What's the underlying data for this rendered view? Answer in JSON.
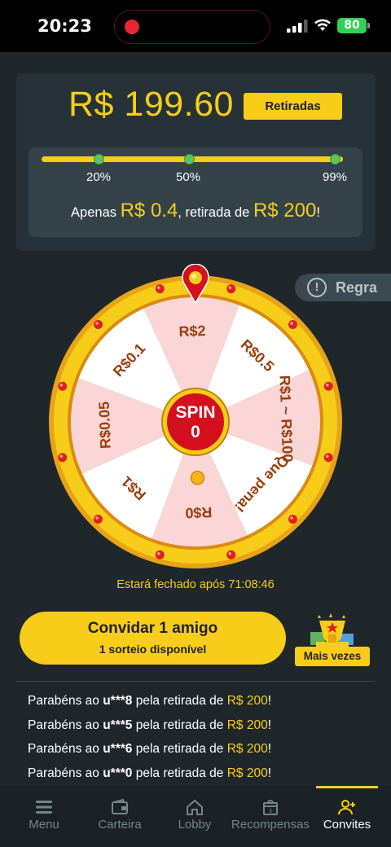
{
  "status_bar": {
    "time": "20:23",
    "battery": "80",
    "icons": [
      "recording-dot-icon",
      "signal-icon",
      "wifi-icon",
      "battery-icon"
    ]
  },
  "balance_card": {
    "amount": "R$ 199.60",
    "withdraw_button": "Retiradas",
    "progress": {
      "markers": [
        "20%",
        "50%",
        "99%"
      ],
      "fill_fraction": 0.998,
      "message_prefix": "Apenas ",
      "remaining": "R$ 0.4",
      "message_middle": ", retirada de ",
      "target": "R$ 200",
      "message_suffix": "!"
    }
  },
  "rule": {
    "icon": "exclamation-circle-icon",
    "label": "Regra"
  },
  "wheel": {
    "segments": [
      "R$2",
      "R$0.5",
      "R$1 ~ R$100",
      "Que pena!",
      "R$0",
      "R$1",
      "R$0.05",
      "R$0.1"
    ],
    "spin_label": "SPIN",
    "spin_count": "0",
    "colors": {
      "light": "#ffffff",
      "pink": "#fad6d6",
      "rim": "#f7cd1a",
      "rim_dark": "#e8a317",
      "text": "#9a3d0c",
      "bulb": "#e02020"
    }
  },
  "timer": "Estará fechado após 71:08:46",
  "invite": {
    "title": "Convidar 1 amigo",
    "subtitle": "1 sorteio disponível",
    "more_label": "Mais vezes"
  },
  "winners": [
    {
      "prefix": "Parabéns ao ",
      "user": "u***8",
      "middle": " pela retirada de ",
      "amount": "R$ 200",
      "suffix": "!"
    },
    {
      "prefix": "Parabéns ao ",
      "user": "u***5",
      "middle": " pela retirada de ",
      "amount": "R$ 200",
      "suffix": "!"
    },
    {
      "prefix": "Parabéns ao ",
      "user": "u***6",
      "middle": " pela retirada de ",
      "amount": "R$ 200",
      "suffix": "!"
    },
    {
      "prefix": "Parabéns ao ",
      "user": "u***0",
      "middle": " pela retirada de ",
      "amount": "R$ 200",
      "suffix": "!"
    }
  ],
  "bottom_nav": [
    {
      "label": "Menu",
      "icon": "menu-icon"
    },
    {
      "label": "Carteira",
      "icon": "wallet-icon"
    },
    {
      "label": "Lobby",
      "icon": "home-icon"
    },
    {
      "label": "Recompensas",
      "icon": "gift-icon"
    },
    {
      "label": "Convites",
      "icon": "add-user-icon",
      "active": true
    }
  ]
}
